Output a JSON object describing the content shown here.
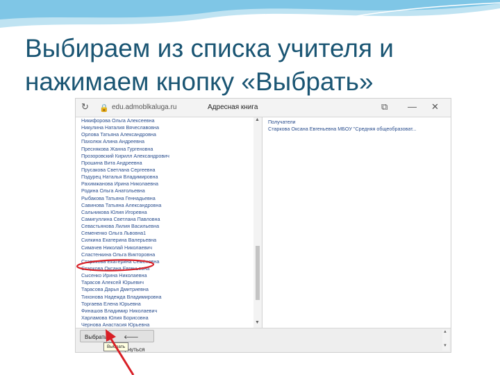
{
  "slide": {
    "title_line1": "Выбираем из списка учителя и",
    "title_line2": "нажимаем кнопку «Выбрать»"
  },
  "window": {
    "domain": "edu.admoblkaluga.ru",
    "title": "Адресная книга",
    "icons": [
      "reload-icon",
      "lock-icon",
      "copy-icon",
      "minimize-icon",
      "close-icon"
    ]
  },
  "teachers": [
    "Никифорова Ольга Алексеевна",
    "Никулина Наталия Вячеславовна",
    "Орлова Татьяна Александровна",
    "Пахолюк Алина Андреевна",
    "Преснякова Жанна Гургеновна",
    "Прозоровский Кирилл Александрович",
    "Прошина Вита Андреевна",
    "Прусакова Светлана Сергеевна",
    "Пэдурец Наталья Владимировна",
    "Рахимжанова Ирина Николаевна",
    "Родина Ольга Анатольевна",
    "Рыбакова Татьяна Геннадьевна",
    "Савинова Татьяна Александровна",
    "Сальникова Юлия Игоревна",
    "Самигуллина Светлана Павловна",
    "Севастьянова Лилия Васильевна",
    "Семененко Ольга Львовна1",
    "Силкина Екатерина Валерьевна",
    "Симачев Николай Николаевич",
    "Сластенкина Ольга Викторовна",
    "Старикова Екатерина Семёновна",
    "Старкова Оксана Евгеньевна",
    "Сысенко Ирина Николаевна",
    "Тарасов Алексей Юрьевич",
    "Тарасова Дарья Дмитриевна",
    "Тихонова Надежда Владимировна",
    "Торгаева Елена Юрьевна",
    "Финашов Владимир Николаевич",
    "Харламова Юлия Борисовна",
    "Чернова Анастасия Юрьевна"
  ],
  "recipients": {
    "header": "Получатели",
    "item": "Старкова Оксана Евгеньевна МБОУ \"Средняя общеобразоват..."
  },
  "buttons": {
    "select": "Выбрать",
    "back": "Вернуться",
    "back_icon": "arrow-left-icon"
  },
  "tooltip": "Выбрать",
  "colors": {
    "title": "#1a5573",
    "link": "#2a4e8e",
    "annotation": "#d81f26"
  }
}
